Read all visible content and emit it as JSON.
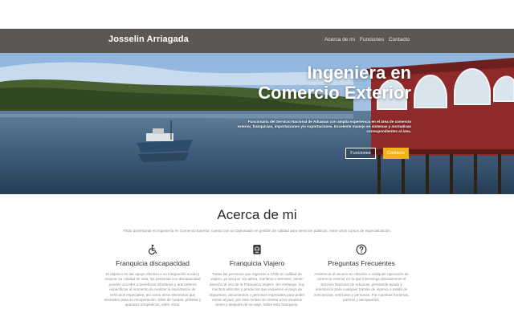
{
  "nav": {
    "brand": "Josselin Arriagada",
    "links": [
      "Acerca de mi",
      "Funciones",
      "Contacto"
    ]
  },
  "hero": {
    "title_line1": "Ingeniera en",
    "title_line2": "Comercio Exterior",
    "subtitle": "Funcionaria del Servicio Nacional de Aduanas con amplia experiencia en el área de comercio exterior, franquicias, importaciones y/o exportaciones. Excelente manejo en sistemas y normativas correspondientes al área.",
    "buttons": [
      "Funciones",
      "Contacto"
    ]
  },
  "about": {
    "title": "Acerca de mi",
    "intro": "Título profesional en Ingeniería en Comercio Exterior, cuento con un Diplomado en gestión de calidad para servicios públicos, entre otros cursos de especialización.",
    "features": [
      {
        "icon": "wheelchair-icon",
        "title": "Franquicia discapacidad",
        "text": "El objetivo es dar apoyo efectivo a su integración social y mejorar su calidad de vida, las personas con discapacidad pueden acceder a beneficios tributarios y aranceleros específicos al momento de realizar la importación de vehículos especiales, así como otros elementos que necesiten para su recuperación: sillas de ruedas, prótesis y aparatos ortopédicos, entre otros."
      },
      {
        "icon": "passport-icon",
        "title": "Franquicia Viajero",
        "text": "Todas las personas que ingresan a Chile en calidad de viajero, ya sea por vía aérea, marítima o terrestre, tienen derecho al uso de la Franquicia Viajero. Sin embargo, hay muchos artículos y productos que requieren el pago de impuestos, documentos o permisos especiales para poder entrar al país, por este motivo se orienta a los usuarios antes y después de su viaje, sobre esta franquicia."
      },
      {
        "icon": "question-icon",
        "title": "Preguntas Frecuentes",
        "text": "Asistencia al usuario en relación a cualquier operación de comercio exterior en la que intervenga directamente el Servicio Nacional de Aduanas, prestando ayuda y orientación para cualquier trámite de ingreso o salida de mercancías, vehículos y personas. Por nuestras fronteras, puertos y aeropuertos."
      }
    ]
  },
  "colors": {
    "navbar": "#5b5754",
    "accent": "#f5b31b",
    "house": "#8e2a2a"
  }
}
